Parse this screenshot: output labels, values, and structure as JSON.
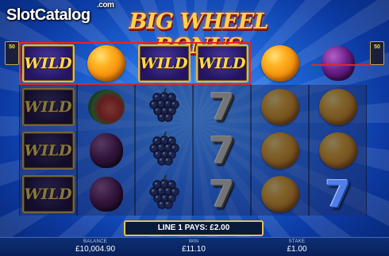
{
  "watermark": {
    "text": "SlotCatalog",
    "suffix": ".com"
  },
  "title": "BIG WHEEL BONUS",
  "line_markers": {
    "left": "50",
    "right": "50"
  },
  "reels": [
    [
      "WILD",
      "orange",
      "WILD",
      "WILD",
      "orange",
      "plum"
    ],
    [
      "WILD",
      "watermelon",
      "grapes",
      "7",
      "orange",
      "orange"
    ],
    [
      "WILD",
      "plum",
      "grapes",
      "7",
      "orange",
      "orange"
    ],
    [
      "WILD",
      "plum",
      "grapes",
      "7",
      "orange",
      "7"
    ]
  ],
  "win_message": "LINE 1 PAYS: £2.00",
  "status_bar": {
    "balance_label": "BALANCE",
    "balance_value": "£10,004.90",
    "win_label": "WIN",
    "win_value": "£11.10",
    "stake_label": "STAKE",
    "stake_value": "£1.00"
  },
  "colors": {
    "win_line": "#e02626",
    "gold": "#e8b640",
    "background": "#1d64d8"
  }
}
